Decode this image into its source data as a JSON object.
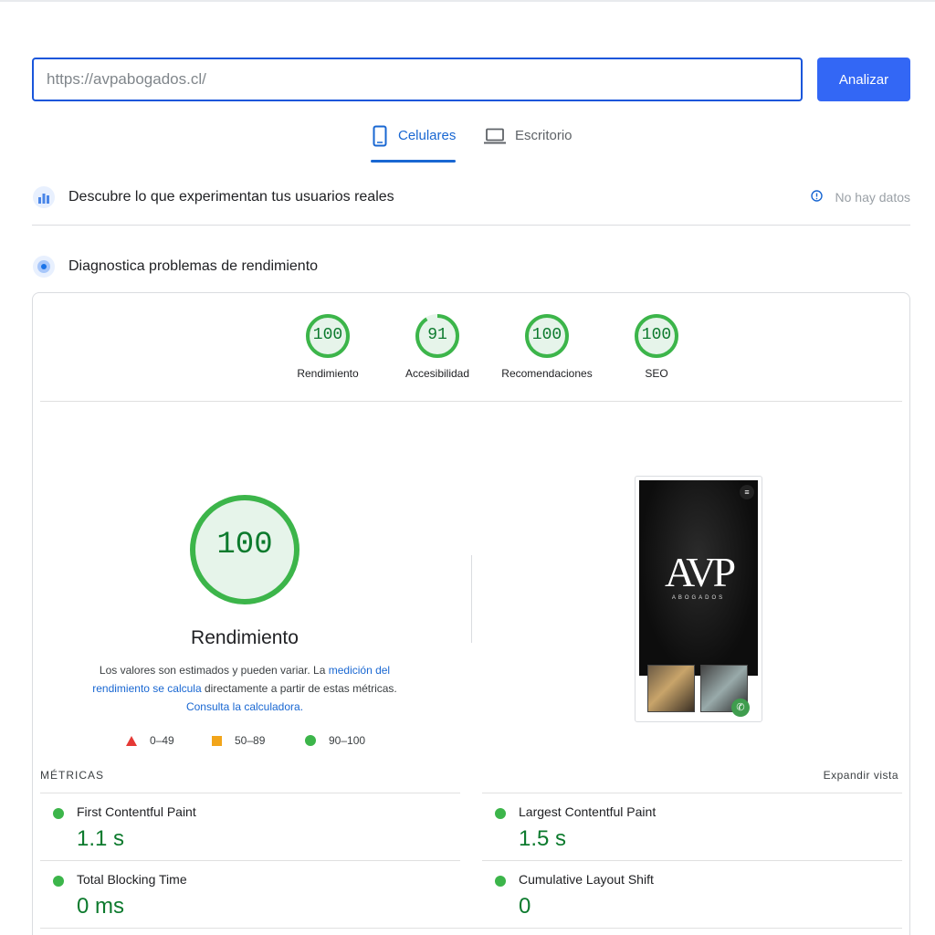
{
  "search": {
    "url_value": "https://avpabogados.cl/",
    "analyze_label": "Analizar"
  },
  "tabs": {
    "mobile_label": "Celulares",
    "desktop_label": "Escritorio"
  },
  "field_data": {
    "title": "Descubre lo que experimentan tus usuarios reales",
    "status": "No hay datos"
  },
  "diagnostics": {
    "title": "Diagnostica problemas de rendimiento"
  },
  "scores": [
    {
      "label": "Rendimiento",
      "value": "100"
    },
    {
      "label": "Accesibilidad",
      "value": "91"
    },
    {
      "label": "Recomendaciones",
      "value": "100"
    },
    {
      "label": "SEO",
      "value": "100"
    }
  ],
  "performance": {
    "score": "100",
    "title": "Rendimiento",
    "desc_part1": "Los valores son estimados y pueden variar. La ",
    "desc_link1": "medición del rendimiento se calcula",
    "desc_part2": " directamente a partir de estas métricas. ",
    "desc_link2": "Consulta la calculadora.",
    "legend": [
      "0–49",
      "50–89",
      "90–100"
    ]
  },
  "screenshot": {
    "logo": "AVP",
    "subtitle": "ABOGADOS"
  },
  "metrics": {
    "header": "MÉTRICAS",
    "expand_label": "Expandir vista",
    "items": [
      {
        "name": "First Contentful Paint",
        "value": "1.1 s"
      },
      {
        "name": "Largest Contentful Paint",
        "value": "1.5 s"
      },
      {
        "name": "Total Blocking Time",
        "value": "0 ms"
      },
      {
        "name": "Cumulative Layout Shift",
        "value": "0"
      }
    ]
  },
  "colors": {
    "accent": "#1967d2",
    "pass": "#3cb54a",
    "pass_text": "#0c7a2d",
    "fail": "#e53935",
    "average": "#f2a51a"
  }
}
